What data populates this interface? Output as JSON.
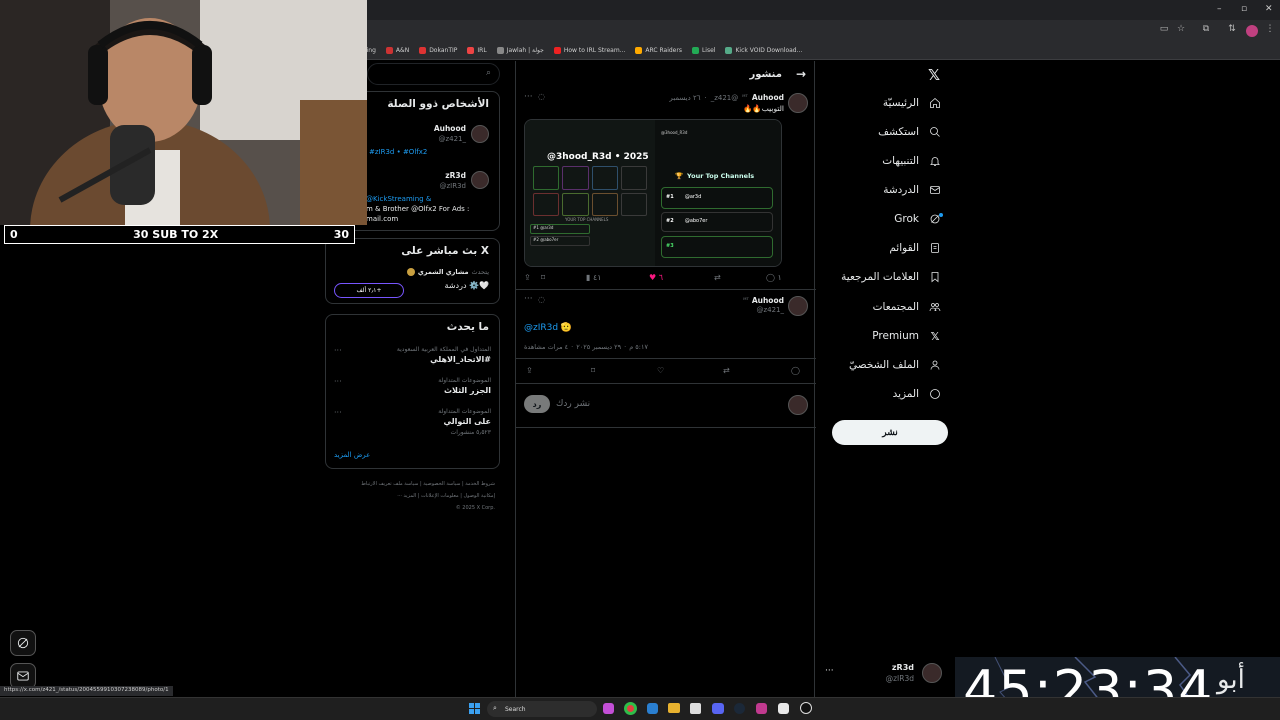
{
  "browser": {
    "bookmarks": [
      "Ding",
      "A&N",
      "DokanTIP",
      "IRL",
      "Jawlah | جولة",
      "How to IRL Stream...",
      "ARC Raiders",
      "Lisel",
      "Kick VOID Download..."
    ],
    "status_url": "https://x.com/z421_/status/2004559910307238089/photo/1"
  },
  "nav": {
    "items": [
      "الرئيسيّة",
      "استكشف",
      "التنبيهات",
      "الدردشة",
      "Grok",
      "القوائم",
      "العلامات المرجعية",
      "المجتمعات",
      "Premium",
      "الملف الشخصيّ",
      "المزيد"
    ],
    "post_button": "نشر",
    "account_name": "zR3d",
    "account_handle": "@zIR3d",
    "more": "···"
  },
  "main": {
    "header_title": "منشور",
    "tweet1": {
      "name": "Auhood",
      "handle": "@z421_",
      "date": "٢٦ ديسمبر",
      "text": "التوبيب🔥🔥",
      "likes": "٦",
      "views": "٤١",
      "replies": "١"
    },
    "media": {
      "title": "@3hood_R3d • 2025",
      "top_channels": "Your Top Channels",
      "rank1": "#1",
      "ch1": "@ar3d",
      "rank2": "#2",
      "ch2": "@abo7er",
      "rank3": "#3",
      "sub_label": "YOUR TOP CHANNELS",
      "handle_badge": "@3hood_R3d"
    },
    "tweet2": {
      "name": "Auhood",
      "handle": "@z421_",
      "text": "@zIR3d 🫡",
      "meta_time": "٥:١٧ م",
      "meta_date": "٢٩ ديسمبر ٢٠٢٥",
      "meta_views": "٤ مرات مشاهدة"
    },
    "reply_placeholder": "نشر ردك",
    "reply_button": "رد"
  },
  "sidebar": {
    "search_icon": "search-icon",
    "relevant_title": "الأشخاص ذوو الصلة",
    "person1_name": "Auhood",
    "person1_handle": "@z421_",
    "person1_bio": "#zIR3d • #Olfx2",
    "person2_name": "zR3d",
    "person2_handle": "@zIR3d",
    "person2_bio_line1": "@KickStreaming & ",
    "person2_bio_line2": "m & Brother @Olfx2 For Ads :",
    "person2_bio_line3": "mail.com",
    "live_title": "X بث مباشر على",
    "live_host": "مشاري الشمري",
    "live_speaking": "يتحدث",
    "live_topic": "🤍⚙️ دردشة",
    "live_count": "+٢٫١ ألف",
    "trends_title": "ما يحدث",
    "trends": [
      {
        "small": "المتداول في المملكة العربية السعودية",
        "big": "#الاتحاد_الاهلي",
        "count": ""
      },
      {
        "small": "الموضوعات المتداولة",
        "big": "الجزر الثلاث",
        "count": ""
      },
      {
        "small": "الموضوعات المتداولة",
        "big": "على التوالي",
        "count": "٥٫٥٢٣ منشورات"
      }
    ],
    "show_more": "عرض المزيد",
    "footer_line1": "شروط الخدمة  |  سياسة الخصوصية  |  سياسة ملف تعريف الارتباط",
    "footer_line2": "إمكانية الوصول  |  معلومات الإعلانات  |  المزيد ···",
    "footer_line3": "© 2025 X Corp."
  },
  "overlay": {
    "sub_left": "0",
    "sub_center": "30 SUB TO 2X",
    "sub_right": "30",
    "timer": "45:23:34",
    "timer_logo": "أبو"
  },
  "taskbar": {
    "search": "Search"
  }
}
